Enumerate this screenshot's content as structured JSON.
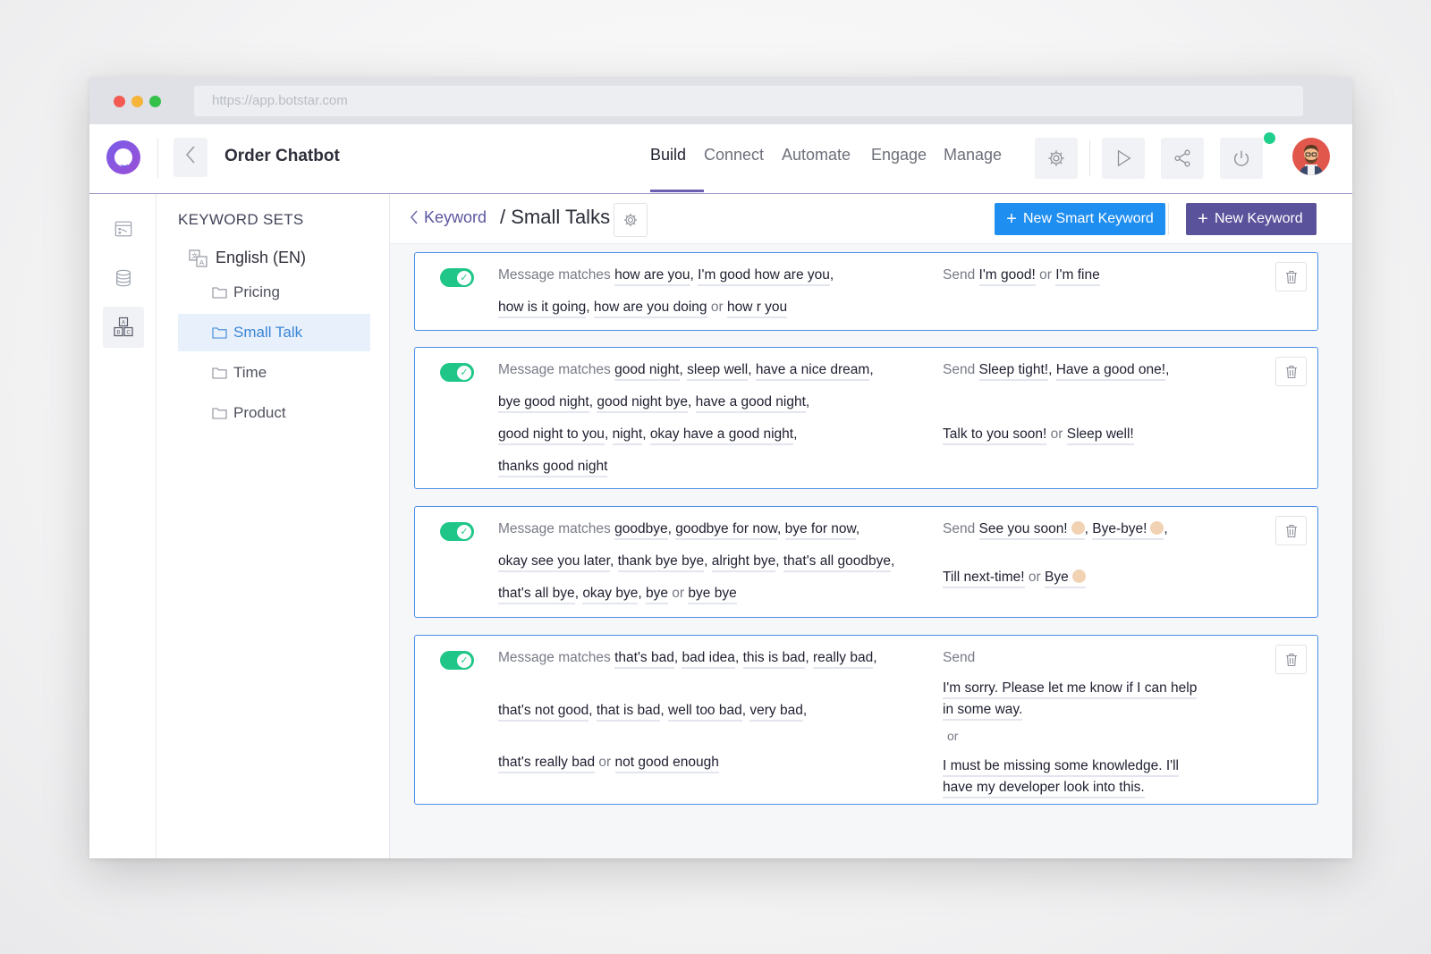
{
  "browser": {
    "url": "https://app.botstar.com"
  },
  "header": {
    "app_title": "Order Chatbot",
    "nav": [
      "Build",
      "Connect",
      "Automate",
      "Engage",
      "Manage"
    ],
    "active_nav": "Build"
  },
  "sidebar": {
    "heading": "KEYWORD SETS",
    "language": "English (EN)",
    "folders": [
      "Pricing",
      "Small Talk",
      "Time",
      "Product"
    ],
    "selected": "Small Talk"
  },
  "main": {
    "breadcrumb_back": "Keyword",
    "title": "/ Small Talks",
    "new_smart_keyword": "New Smart Keyword",
    "new_keyword": "New Keyword"
  },
  "labels": {
    "matches": "Message matches",
    "send": "Send",
    "or": "or"
  },
  "rules": [
    {
      "match_lines": [
        [
          "how are you",
          "I'm good how are you"
        ],
        [
          "how is it going",
          "how are you doing",
          "how r you"
        ]
      ],
      "send_lines": [
        [
          "I'm good!",
          "I'm fine"
        ]
      ]
    },
    {
      "match_lines": [
        [
          "good night",
          "sleep well",
          "have a nice dream"
        ],
        [
          "bye good night",
          "good night bye",
          "have a good night"
        ],
        [
          "good night to you",
          "night",
          "okay have a good night"
        ],
        [
          "thanks good night"
        ]
      ],
      "send_lines": [
        [
          "Sleep tight!",
          "Have a good one!"
        ],
        [
          "Talk to you soon!",
          "Sleep well!"
        ]
      ]
    },
    {
      "match_lines": [
        [
          "goodbye",
          "goodbye for now",
          "bye for now"
        ],
        [
          "okay see you later",
          "thank bye bye",
          "alright bye",
          "that's all goodbye"
        ],
        [
          "that's all bye",
          "okay bye",
          "bye",
          "bye bye"
        ]
      ],
      "send_lines": [
        [
          "See you soon!",
          "Bye-bye!"
        ],
        [
          "Till next-time!",
          "Bye"
        ]
      ]
    },
    {
      "match_lines": [
        [
          "that's bad",
          "bad idea",
          "this is bad",
          "really bad"
        ],
        [
          "that's not good",
          "that is bad",
          "well too bad",
          "very bad"
        ],
        [
          "that's really bad",
          "not good enough"
        ]
      ],
      "send_blocks": [
        [
          "I'm sorry. Please let me know if I can help",
          "in some way."
        ],
        [
          "I must be missing some knowledge. I'll",
          "have my developer look into this."
        ]
      ]
    }
  ]
}
